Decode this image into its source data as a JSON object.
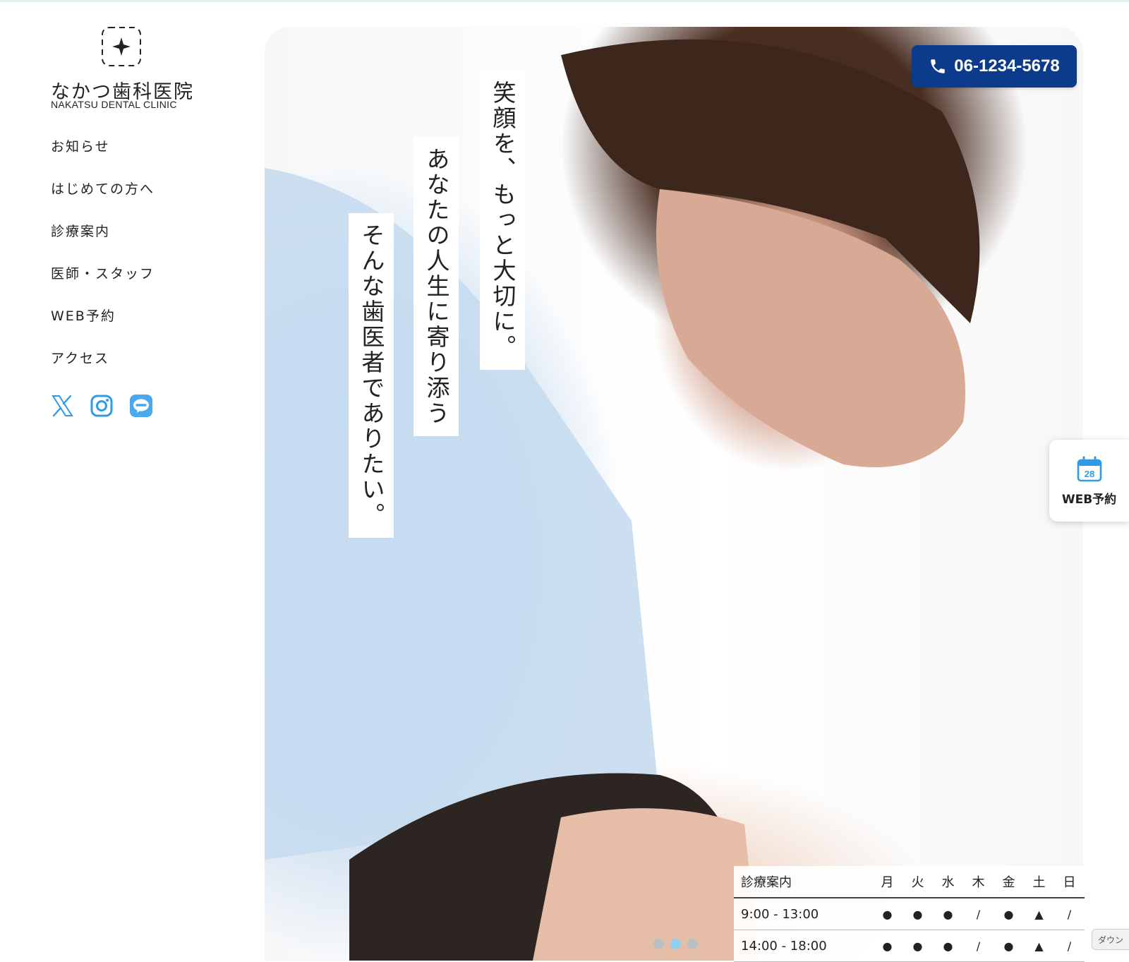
{
  "clinic": {
    "name_jp": "なかつ歯科医院",
    "name_en": "NAKATSU DENTAL CLINIC"
  },
  "nav": {
    "items": [
      "お知らせ",
      "はじめての方へ",
      "診療案内",
      "医師・スタッフ",
      "WEB予約",
      "アクセス"
    ]
  },
  "social": [
    "x-icon",
    "instagram-icon",
    "line-icon"
  ],
  "hero": {
    "copy": [
      "笑顔を、もっと大切に。",
      "あなたの人生に寄り添う",
      "そんな歯医者でありたい。"
    ],
    "phone": "06-1234-5678",
    "slides_total": 3,
    "slide_active": 2
  },
  "web_booking": {
    "label": "WEB予約",
    "calendar_day": "28"
  },
  "hours": {
    "title": "診療案内",
    "days": [
      "月",
      "火",
      "水",
      "木",
      "金",
      "土",
      "日"
    ],
    "rows": [
      {
        "time": "9:00 - 13:00",
        "marks": [
          "●",
          "●",
          "●",
          "/",
          "●",
          "▲",
          "/"
        ]
      },
      {
        "time": "14:00 - 18:00",
        "marks": [
          "●",
          "●",
          "●",
          "/",
          "●",
          "▲",
          "/"
        ]
      }
    ]
  },
  "download_tab": "ダウン",
  "colors": {
    "phone_bg": "#0b3b8a",
    "accent_blue": "#2e9be6",
    "dot_active": "#8fd0f0"
  }
}
